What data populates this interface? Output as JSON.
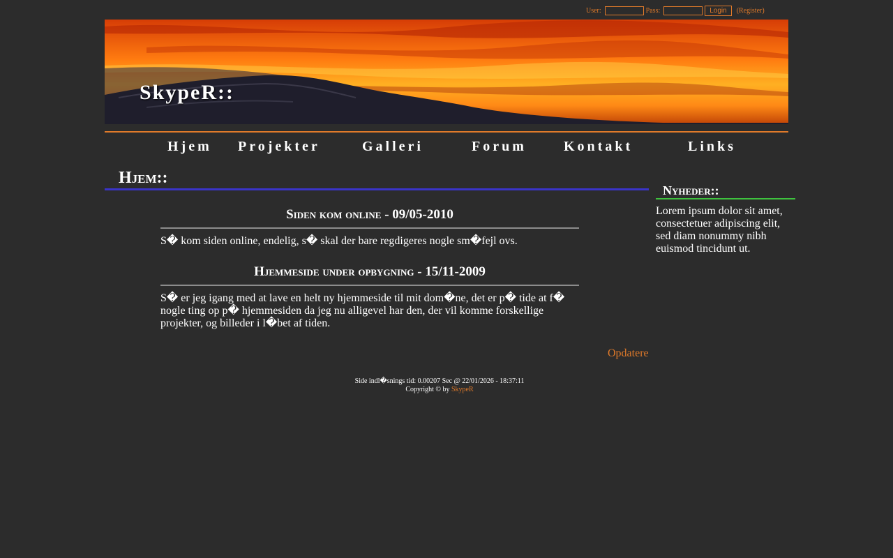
{
  "login": {
    "user_label": "User:",
    "user_value": "",
    "pass_label": "Pass:",
    "pass_value": "",
    "login_button": "Login",
    "register_link": "(Register)"
  },
  "header": {
    "site_title": "SkypeR::"
  },
  "nav": {
    "items": [
      "Hjem",
      "Projekter",
      "Galleri",
      "Forum",
      "Kontakt",
      "Links"
    ]
  },
  "main": {
    "heading": "Hjem::",
    "entries": [
      {
        "title": "Siden kom online - 09/05-2010",
        "body": "S� kom siden online, endelig, s� skal der bare regdigeres nogle sm�fejl ovs."
      },
      {
        "title": "Hjemmeside under opbygning - 15/11-2009",
        "body": "S� er jeg igang med at lave en helt ny hjemmeside til mit dom�ne, det er p� tide at f� nogle ting op p� hjemmesiden da jeg nu alligevel har den, der vil komme forskellige projekter, og billeder i l�bet af tiden."
      }
    ],
    "update_link": "Opdatere"
  },
  "sidebar": {
    "heading": "Nyheder::",
    "body": "Lorem ipsum dolor sit amet, consectetuer adipiscing elit, sed diam nonummy nibh euismod tincidunt ut."
  },
  "footer": {
    "load_time": "Side indl�snings tid: 0.00207 Sec @ 22/01/2026 - 18:37:11",
    "copyright_prefix": "Copyright © by",
    "copyright_link": "SkypeR"
  },
  "colors": {
    "background": "#2c2c2c",
    "accent_orange": "#e07a2a",
    "heading_rule_blue": "#3a34c8",
    "sidebar_rule_green": "#3ec23e"
  },
  "icons": {
    "banner": "sunset-mountain-image"
  }
}
